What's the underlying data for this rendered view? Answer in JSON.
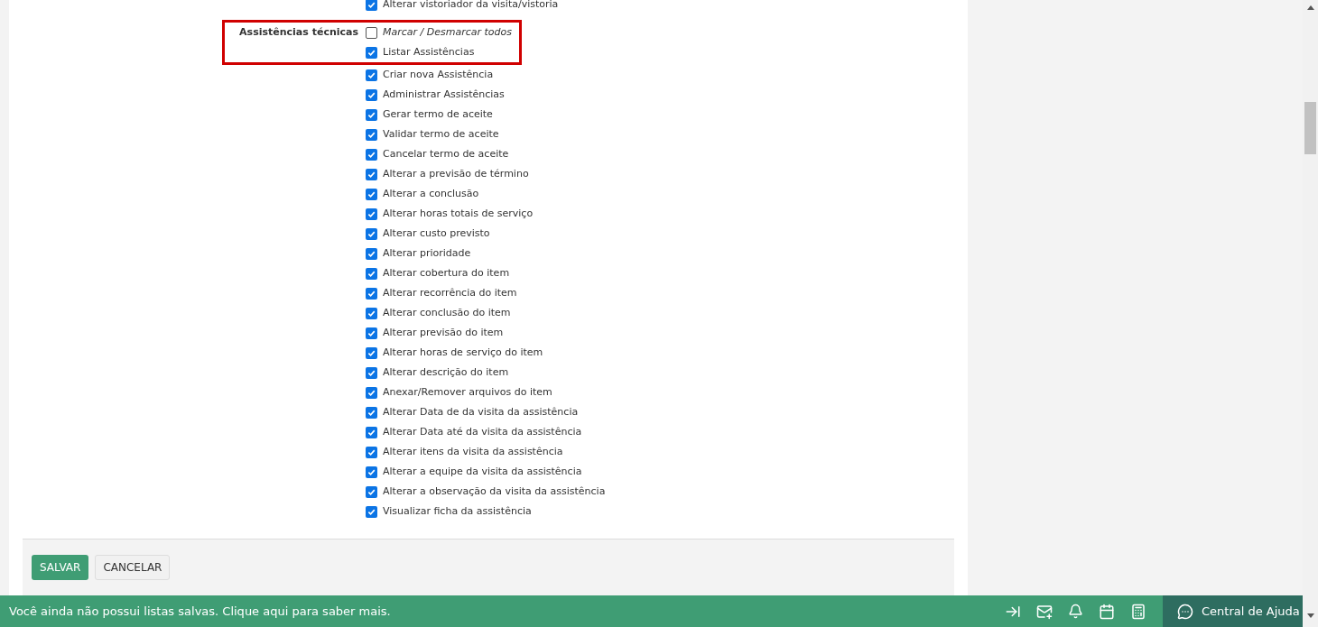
{
  "previous_items": [
    {
      "label": "Alterar vistoriador da visita/vistoria",
      "checked": true
    }
  ],
  "section": {
    "label": "Assistências técnicas",
    "highlighted": true,
    "toggle_all": {
      "label": "Marcar / Desmarcar todos",
      "checked": false
    },
    "items": [
      {
        "label": "Listar Assistências",
        "checked": true
      },
      {
        "label": "Criar nova Assistência",
        "checked": true
      },
      {
        "label": "Administrar Assistências",
        "checked": true
      },
      {
        "label": "Gerar termo de aceite",
        "checked": true
      },
      {
        "label": "Validar termo de aceite",
        "checked": true
      },
      {
        "label": "Cancelar termo de aceite",
        "checked": true
      },
      {
        "label": "Alterar a previsão de término",
        "checked": true
      },
      {
        "label": "Alterar a conclusão",
        "checked": true
      },
      {
        "label": "Alterar horas totais de serviço",
        "checked": true
      },
      {
        "label": "Alterar custo previsto",
        "checked": true
      },
      {
        "label": "Alterar prioridade",
        "checked": true
      },
      {
        "label": "Alterar cobertura do item",
        "checked": true
      },
      {
        "label": "Alterar recorrência do item",
        "checked": true
      },
      {
        "label": "Alterar conclusão do item",
        "checked": true
      },
      {
        "label": "Alterar previsão do item",
        "checked": true
      },
      {
        "label": "Alterar horas de serviço do item",
        "checked": true
      },
      {
        "label": "Alterar descrição do item",
        "checked": true
      },
      {
        "label": "Anexar/Remover arquivos do item",
        "checked": true
      },
      {
        "label": "Alterar Data de da visita da assistência",
        "checked": true
      },
      {
        "label": "Alterar Data até da visita da assistência",
        "checked": true
      },
      {
        "label": "Alterar itens da visita da assistência",
        "checked": true
      },
      {
        "label": "Alterar a equipe da visita da assistência",
        "checked": true
      },
      {
        "label": "Alterar a observação da visita da assistência",
        "checked": true
      },
      {
        "label": "Visualizar ficha da assistência",
        "checked": true
      }
    ]
  },
  "actions": {
    "save": "SALVAR",
    "cancel": "CANCELAR"
  },
  "footer": {
    "message": "Você ainda não possui listas salvas. Clique aqui para saber mais.",
    "help": "Central de Ajuda"
  }
}
